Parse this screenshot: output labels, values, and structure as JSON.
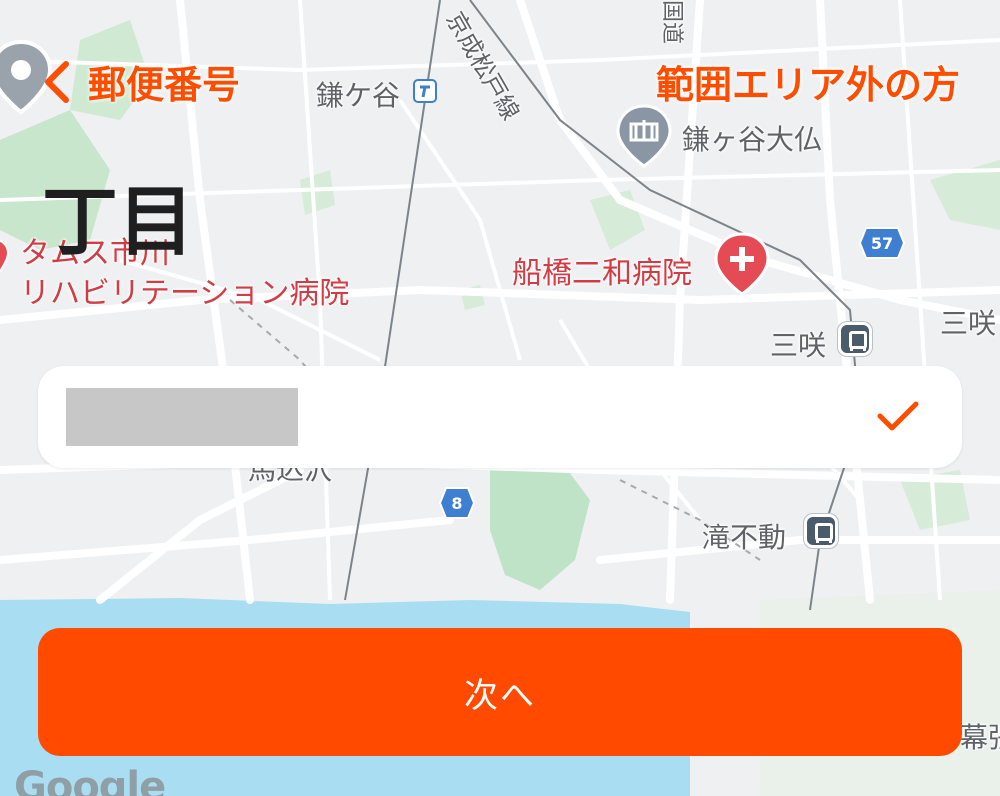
{
  "header": {
    "back_label": "郵便番号",
    "out_of_area_label": "範囲エリア外の方"
  },
  "page_title": "丁目",
  "input": {
    "value": ""
  },
  "next_button_label": "次へ",
  "map": {
    "labels": {
      "station_kamagaya": "鎌ケ谷",
      "railway_line": "京成松戸線",
      "road_partial": "国道",
      "temple": "鎌ヶ谷大仏",
      "hospital_tamusu_line1": "タムス市川",
      "hospital_tamusu_line2": "リハビリテーション病院",
      "hospital_funabashi": "船橋二和病院",
      "station_misaki": "三咲",
      "area_misaki_right": "三咲",
      "station_takifudo": "滝不動",
      "partial_makuhari": "幕張",
      "partial_station_below_card": "馬込沢"
    },
    "route_57": "57",
    "route_8": "8",
    "google_logo": "Google"
  },
  "colors": {
    "accent": "#ff4a00",
    "map_background": "#eef0f2",
    "park": "#bfe3c6",
    "water": "#a9def2",
    "poi_red": "#e54b55",
    "poi_gray": "#8a96a3",
    "route_blue": "#3f7fd1"
  }
}
